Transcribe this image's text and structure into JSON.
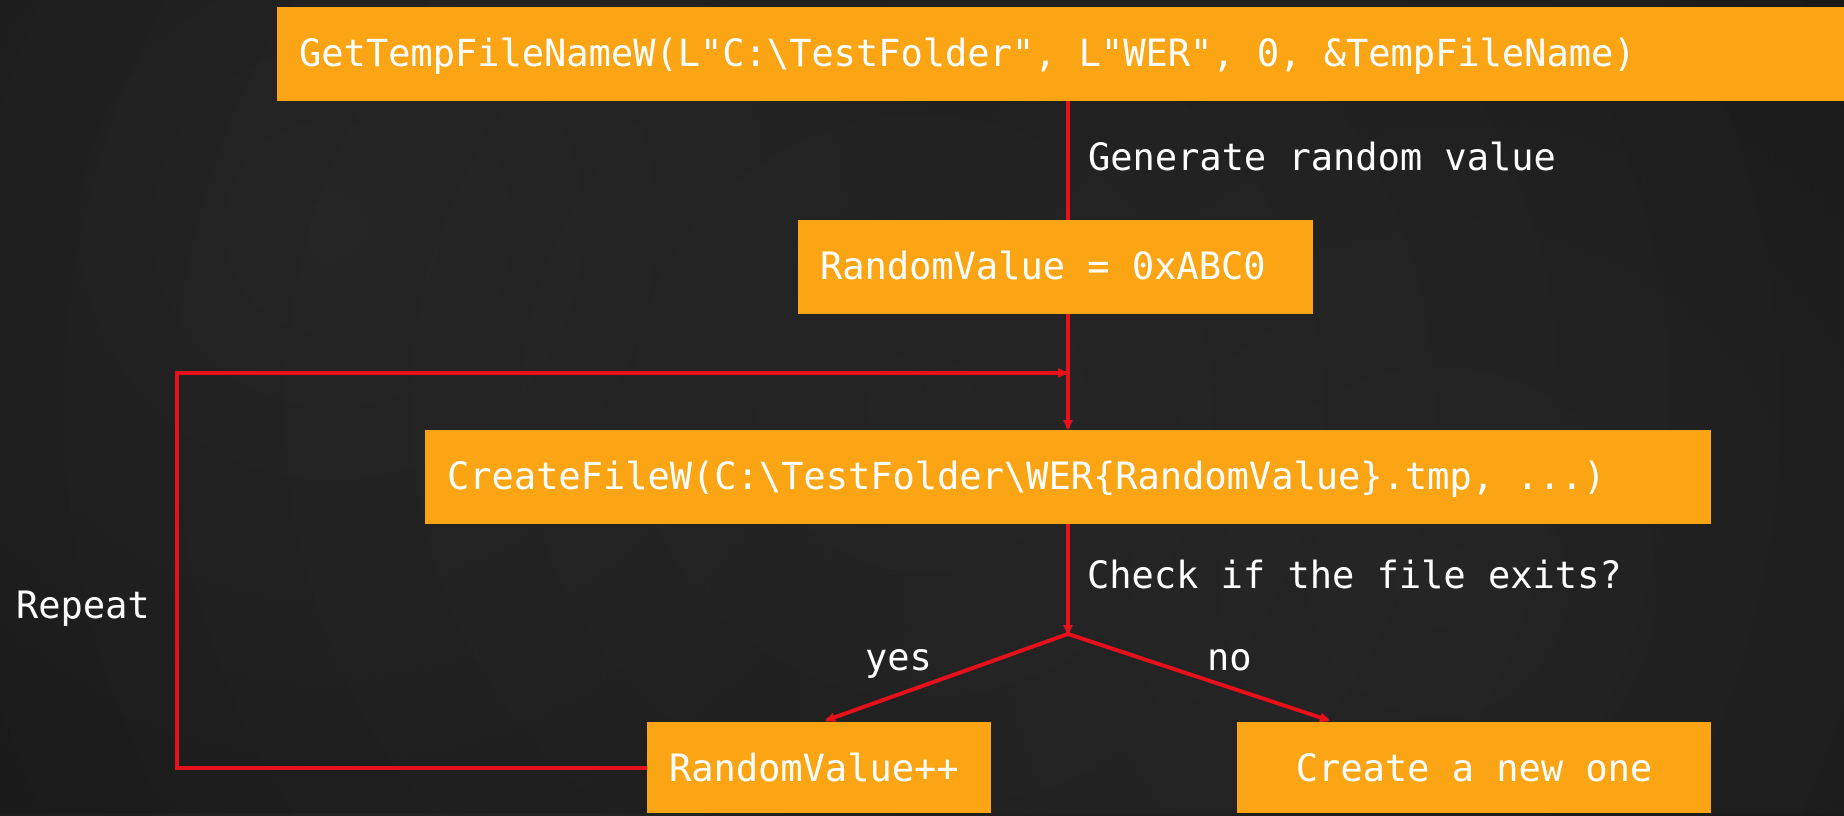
{
  "boxes": {
    "get_temp_filename": "GetTempFileNameW(L\"C:\\TestFolder\", L\"WER\", 0, &TempFileName)",
    "random_value": "RandomValue = 0xABC0",
    "create_file": "CreateFileW(C:\\TestFolder\\WER{RandomValue}.tmp, ...)",
    "increment": "RandomValue++",
    "create_new": "Create a new one"
  },
  "labels": {
    "generate": "Generate random value",
    "check": "Check if the file exits?",
    "yes": "yes",
    "no": "no",
    "repeat": "Repeat"
  },
  "colors": {
    "background": "#232323",
    "box_fill": "#FBA414",
    "text": "#FFFFFF",
    "arrow": "#E8101A"
  }
}
